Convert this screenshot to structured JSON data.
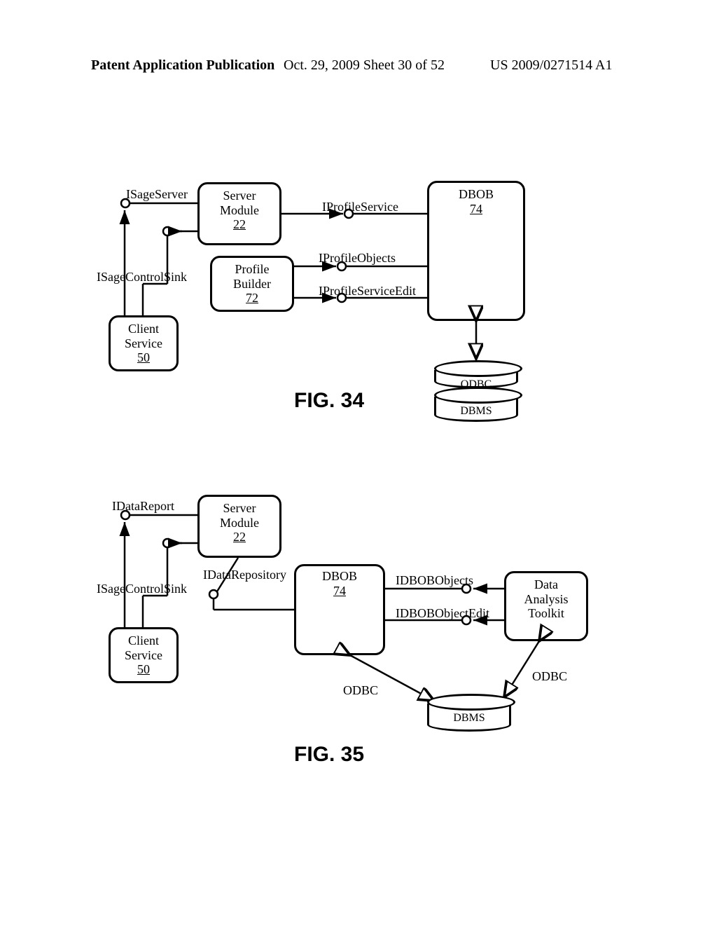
{
  "header": {
    "left": "Patent Application Publication",
    "mid": "Oct. 29, 2009  Sheet 30 of 52",
    "right": "US 2009/0271514 A1"
  },
  "fig34": {
    "caption": "FIG. 34",
    "serverModule": {
      "title": "Server\nModule",
      "num": "22"
    },
    "profileBuilder": {
      "title": "Profile\nBuilder",
      "num": "72"
    },
    "clientService": {
      "title": "Client\nService",
      "num": "50"
    },
    "dbob": {
      "title": "DBOB",
      "num": "74"
    },
    "iSageServer": "ISageServer",
    "iSageControlSink": "ISageControlSink",
    "iProfileService": "IProfileService",
    "iProfileObjects": "IProfileObjects",
    "iProfileServiceEdit": "IProfileServiceEdit",
    "odbc": "ODBC",
    "dbms": "DBMS"
  },
  "fig35": {
    "caption": "FIG. 35",
    "serverModule": {
      "title": "Server\nModule",
      "num": "22"
    },
    "clientService": {
      "title": "Client\nService",
      "num": "50"
    },
    "dbob": {
      "title": "DBOB",
      "num": "74"
    },
    "dataAnalysis": {
      "title": "Data\nAnalysis\nToolkit"
    },
    "iDataReport": "IDataReport",
    "iSageControlSink": "ISageControlSink",
    "iDataRepository": "IDataRepository",
    "iDBOBObjects": "IDBOBObjects",
    "iDBOBObjectEdit": "IDBOBObjectEdit",
    "odbc": "ODBC",
    "dbms": "DBMS"
  }
}
